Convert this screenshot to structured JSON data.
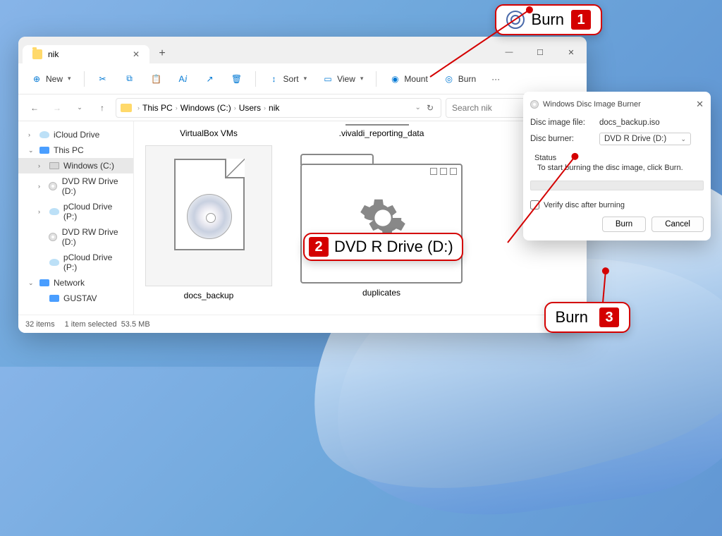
{
  "explorer": {
    "tab_title": "nik",
    "toolbar": {
      "new": "New",
      "sort": "Sort",
      "view": "View",
      "mount": "Mount",
      "burn": "Burn",
      "more": "···"
    },
    "breadcrumbs": [
      "This PC",
      "Windows (C:)",
      "Users",
      "nik"
    ],
    "search_placeholder": "Search nik",
    "nav": {
      "items": [
        {
          "label": "iCloud Drive",
          "type": "cloud",
          "chev": ">"
        },
        {
          "label": "This PC",
          "type": "pc",
          "chev": "v"
        },
        {
          "label": "Windows (C:)",
          "type": "drive",
          "chev": ">",
          "sel": true,
          "indent": true
        },
        {
          "label": "DVD RW Drive (D:)",
          "type": "disc",
          "chev": ">",
          "indent": true
        },
        {
          "label": "pCloud Drive (P:)",
          "type": "cloud",
          "chev": ">",
          "indent": true
        },
        {
          "label": "DVD RW Drive (D:)",
          "type": "disc",
          "chev": "",
          "indent": true
        },
        {
          "label": "pCloud Drive (P:)",
          "type": "cloud",
          "chev": "",
          "indent": true
        },
        {
          "label": "Network",
          "type": "net",
          "chev": "v"
        },
        {
          "label": "GUSTAV",
          "type": "pc",
          "chev": "",
          "indent": true
        }
      ]
    },
    "files": {
      "vbox": "VirtualBox VMs",
      "vivaldi": ".vivaldi_reporting_data",
      "docs": "docs_backup",
      "dup": "duplicates"
    },
    "status": {
      "count": "32 items",
      "selected": "1 item selected",
      "size": "53.5 MB"
    }
  },
  "burner": {
    "title": "Windows Disc Image Burner",
    "file_label": "Disc image file:",
    "file_value": "docs_backup.iso",
    "burner_label": "Disc burner:",
    "burner_value": "DVD R Drive (D:)",
    "status_label": "Status",
    "status_text": "To start burning the disc image, click Burn.",
    "verify": "Verify disc after burning",
    "burn_btn": "Burn",
    "cancel_btn": "Cancel"
  },
  "callouts": {
    "c1": "Burn",
    "c2": "DVD R Drive (D:)",
    "c3": "Burn",
    "n1": "1",
    "n2": "2",
    "n3": "3"
  }
}
